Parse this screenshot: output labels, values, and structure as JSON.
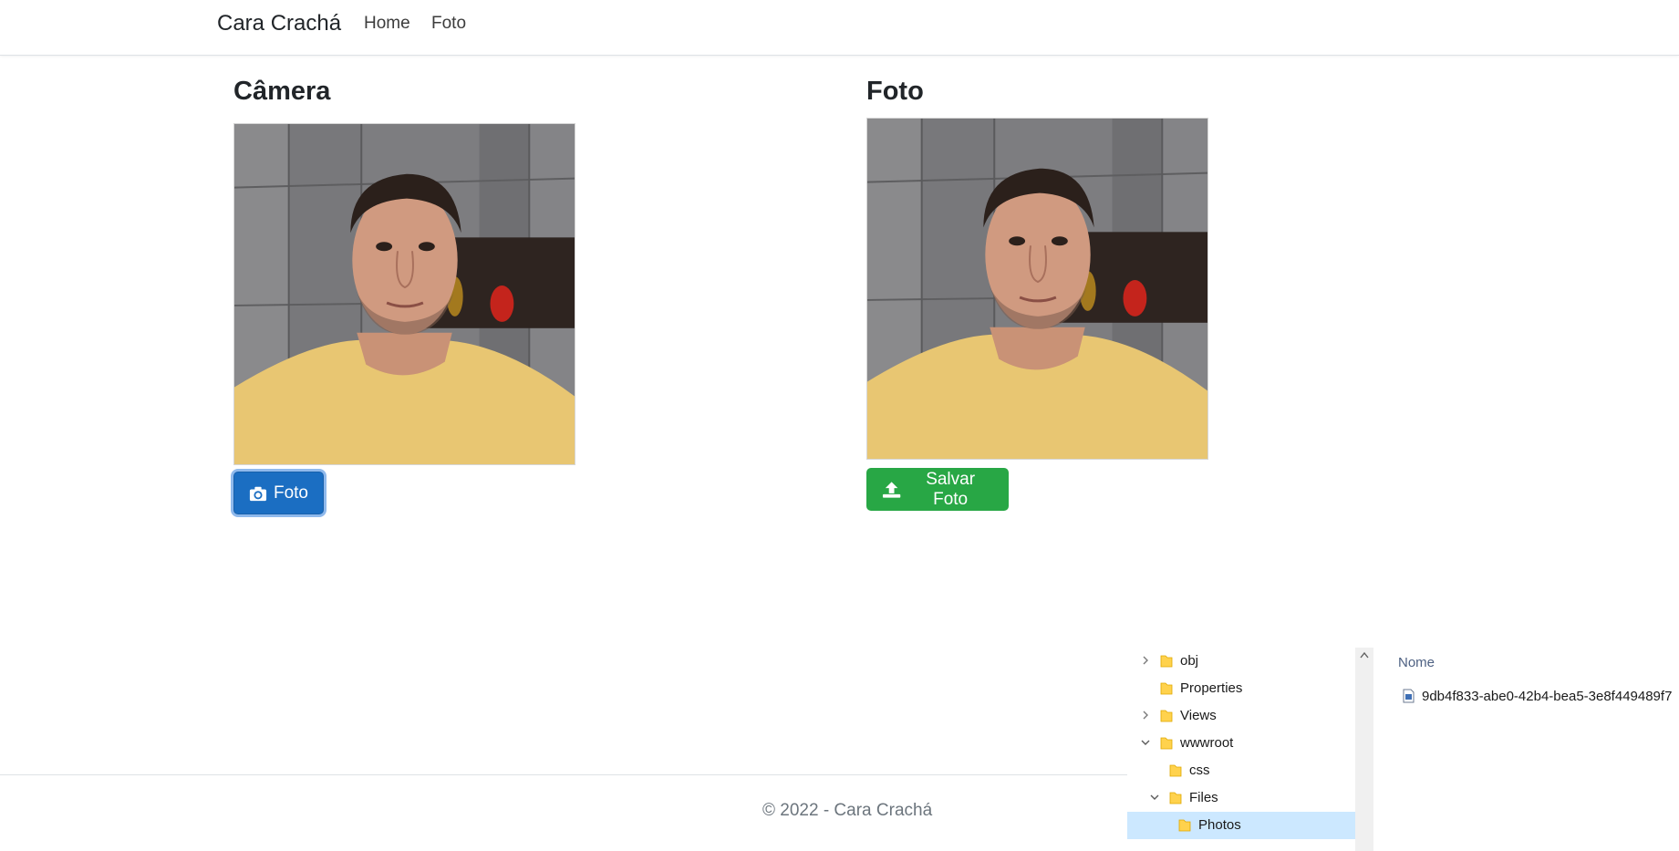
{
  "navbar": {
    "brand": "Cara Crachá",
    "links": [
      "Home",
      "Foto"
    ]
  },
  "camera": {
    "title": "Câmera",
    "button_label": "Foto",
    "button_icon": "camera-icon"
  },
  "foto": {
    "title": "Foto",
    "button_label": "Salvar Foto",
    "button_icon": "upload-icon"
  },
  "footer": {
    "text": "© 2022 - Cara Crachá"
  },
  "explorer": {
    "tree": [
      {
        "label": "obj",
        "expander": "collapsed"
      },
      {
        "label": "Properties",
        "expander": "none"
      },
      {
        "label": "Views",
        "expander": "collapsed"
      },
      {
        "label": "wwwroot",
        "expander": "expanded"
      },
      {
        "label": "css",
        "expander": "none"
      },
      {
        "label": "Files",
        "expander": "expanded"
      },
      {
        "label": "Photos",
        "expander": "none",
        "selected": true
      }
    ],
    "column_header": "Nome",
    "files": [
      "9db4f833-abe0-42b4-bea5-3e8f449489f7"
    ]
  },
  "colors": {
    "primary": "#1b6ec2",
    "success": "#28a745",
    "selection": "#cce8ff",
    "folder": "#ffd24d"
  }
}
